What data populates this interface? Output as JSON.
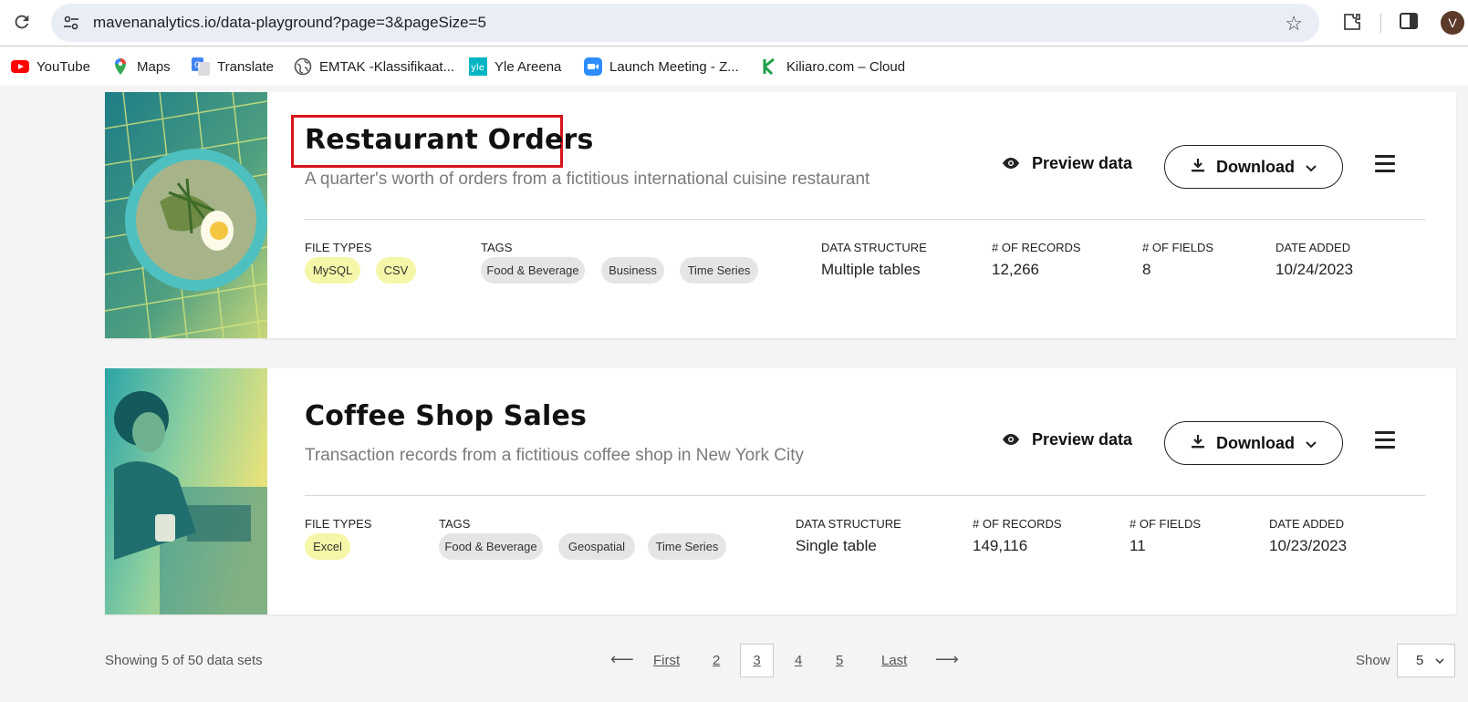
{
  "browser": {
    "url": "mavenanalytics.io/data-playground?page=3&pageSize=5",
    "avatar_letter": "V",
    "bookmarks": [
      {
        "label": "YouTube",
        "icon": "youtube-icon"
      },
      {
        "label": "Maps",
        "icon": "maps-icon"
      },
      {
        "label": "Translate",
        "icon": "translate-icon"
      },
      {
        "label": "EMTAK -Klassifikaat...",
        "icon": "globe-icon"
      },
      {
        "label": "Yle Areena",
        "icon": "yle-icon"
      },
      {
        "label": "Launch Meeting - Z...",
        "icon": "zoom-icon"
      },
      {
        "label": "Kiliaro.com – Cloud",
        "icon": "kiliaro-icon"
      }
    ]
  },
  "labels": {
    "file_types": "FILE TYPES",
    "tags": "TAGS",
    "data_structure": "DATA STRUCTURE",
    "records": "# OF RECORDS",
    "fields": "# OF FIELDS",
    "date_added": "DATE ADDED",
    "preview": "Preview data",
    "download": "Download"
  },
  "datasets": [
    {
      "title": "Restaurant Orders",
      "description": "A quarter's worth of orders from a fictitious international cuisine restaurant",
      "file_types": [
        "MySQL",
        "CSV"
      ],
      "tags": [
        "Food & Beverage",
        "Business",
        "Time Series"
      ],
      "data_structure": "Multiple tables",
      "records": "12,266",
      "fields": "8",
      "date_added": "10/24/2023",
      "highlighted": true
    },
    {
      "title": "Coffee Shop Sales",
      "description": "Transaction records from a fictitious coffee shop in New York City",
      "file_types": [
        "Excel"
      ],
      "tags": [
        "Food & Beverage",
        "Geospatial",
        "Time Series"
      ],
      "data_structure": "Single table",
      "records": "149,116",
      "fields": "11",
      "date_added": "10/23/2023",
      "highlighted": false
    }
  ],
  "pagination": {
    "showing": "Showing 5 of 50 data sets",
    "prev_arrow": "⟵",
    "first": "First",
    "pages": [
      "2",
      "3",
      "4",
      "5"
    ],
    "current": "3",
    "last": "Last",
    "next_arrow": "⟶",
    "show_label": "Show",
    "page_size": "5"
  },
  "colors": {
    "highlight_border": "#d9141b",
    "file_type_chip": "#f5f6a8",
    "tag_chip": "#e5e5e5"
  }
}
